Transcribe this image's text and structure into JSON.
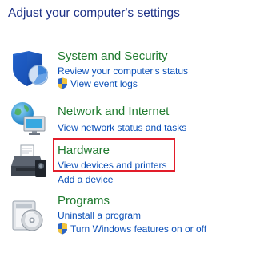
{
  "page": {
    "title": "Adjust your computer's settings"
  },
  "categories": [
    {
      "id": "system-security",
      "title": "System and Security",
      "icon": "shield-security-icon",
      "links": [
        {
          "label": "Review your computer's status",
          "shield": false
        },
        {
          "label": "View event logs",
          "shield": true
        }
      ]
    },
    {
      "id": "network-internet",
      "title": "Network and Internet",
      "icon": "network-globe-icon",
      "links": [
        {
          "label": "View network status and tasks",
          "shield": false
        }
      ]
    },
    {
      "id": "hardware",
      "title": "Hardware",
      "icon": "printer-icon",
      "links": [
        {
          "label": "View devices and printers",
          "shield": false
        },
        {
          "label": "Add a device",
          "shield": false
        }
      ]
    },
    {
      "id": "programs",
      "title": "Programs",
      "icon": "programs-disc-icon",
      "links": [
        {
          "label": "Uninstall a program",
          "shield": false
        },
        {
          "label": "Turn Windows features on or off",
          "shield": true
        }
      ]
    }
  ],
  "colors": {
    "title": "#1e3287",
    "category_title": "#1e7a2e",
    "link": "#0a4fb8",
    "highlight": "#e21d2a"
  }
}
